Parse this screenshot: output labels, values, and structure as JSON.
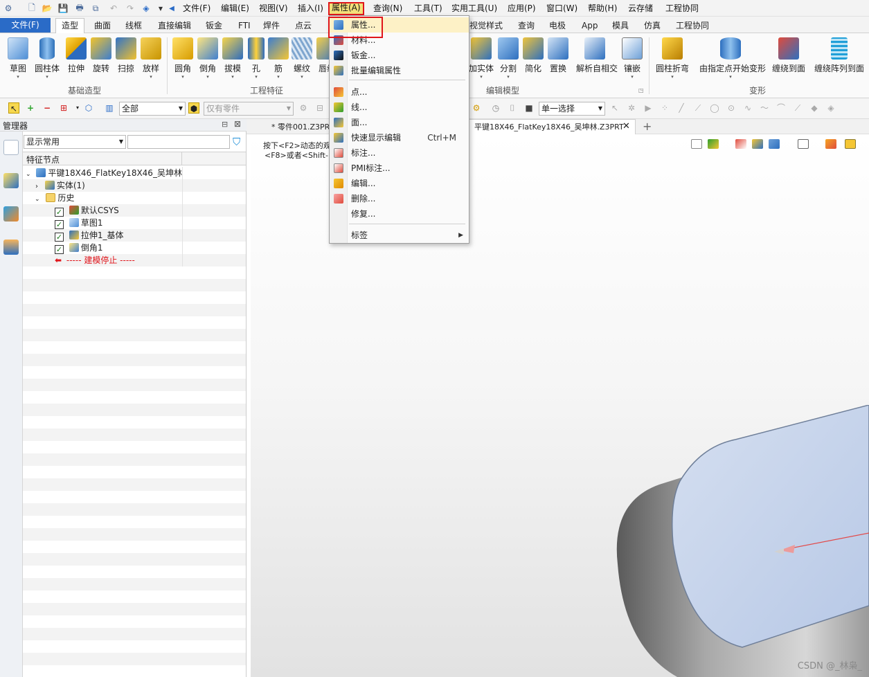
{
  "menubar": {
    "items": [
      "文件(F)",
      "编辑(E)",
      "视图(V)",
      "插入(I)",
      "属性(A)",
      "查询(N)",
      "工具(T)",
      "实用工具(U)",
      "应用(P)",
      "窗口(W)",
      "帮助(H)",
      "云存储",
      "工程协同"
    ],
    "active_index": 4
  },
  "ribbon_tabs": {
    "items": [
      "文件(F)",
      "造型",
      "曲面",
      "线框",
      "直接编辑",
      "钣金",
      "FTI",
      "焊件",
      "点云",
      "视觉样式",
      "查询",
      "电极",
      "App",
      "模具",
      "仿真",
      "工程协同"
    ],
    "selected_index": 1
  },
  "ribbon": {
    "groups": {
      "basic": {
        "label": "基础造型",
        "buttons": [
          "草图",
          "圆柱体",
          "拉伸",
          "旋转",
          "扫掠",
          "放样"
        ]
      },
      "eng": {
        "label": "工程特征",
        "buttons": [
          "圆角",
          "倒角",
          "拔模",
          "孔",
          "筋",
          "螺纹",
          "唇缘"
        ]
      },
      "edit": {
        "label": "编辑模型",
        "buttons": [
          "加实体",
          "分割",
          "简化",
          "置换",
          "解析自相交",
          "镶嵌"
        ]
      },
      "deform": {
        "label": "变形",
        "buttons": [
          "圆柱折弯",
          "由指定点开始变形",
          "缠绕到面",
          "缠绕阵列到面"
        ]
      }
    }
  },
  "toolbar": {
    "filter_value": "全部",
    "parts_placeholder": "仅有零件",
    "select_mode": "单一选择"
  },
  "manager": {
    "title": "管理器",
    "display_mode": "显示常用",
    "column_header": "特征节点",
    "tree": {
      "root": "平键18X46_FlatKey18X46_吴坤林",
      "solid": "实体(1)",
      "history": "历史",
      "children": [
        "默认CSYS",
        "草图1",
        "拉伸1_基体",
        "倒角1"
      ],
      "stop": "----- 建模停止 -----"
    }
  },
  "doc_tabs": {
    "tab1": "* 零件001.Z3PRT",
    "tab2": "平键18X46_FlatKey18X46_吴坤林.Z3PRT"
  },
  "viewport": {
    "hint_line1": "按下<F2>动态的观",
    "hint_line2": "<F8>或者<Shift-ro"
  },
  "dropdown": {
    "items": [
      {
        "label": "属性...",
        "shortcut": ""
      },
      {
        "label": "材料...",
        "shortcut": ""
      },
      {
        "label": "钣金...",
        "shortcut": ""
      },
      {
        "label": "批量编辑属性",
        "shortcut": ""
      },
      {
        "label": "点...",
        "shortcut": ""
      },
      {
        "label": "线...",
        "shortcut": ""
      },
      {
        "label": "面...",
        "shortcut": ""
      },
      {
        "label": "快速显示编辑",
        "shortcut": "Ctrl+M"
      },
      {
        "label": "标注...",
        "shortcut": ""
      },
      {
        "label": "PMI标注...",
        "shortcut": ""
      },
      {
        "label": "编辑...",
        "shortcut": ""
      },
      {
        "label": "删除...",
        "shortcut": ""
      },
      {
        "label": "修复...",
        "shortcut": ""
      },
      {
        "label": "标签",
        "shortcut": ""
      }
    ]
  },
  "watermark": "CSDN @_林枭_",
  "colors": {
    "file_tab": "#2a6bc7",
    "highlight_red": "#e0151b",
    "menu_active": "#f4e07a"
  }
}
